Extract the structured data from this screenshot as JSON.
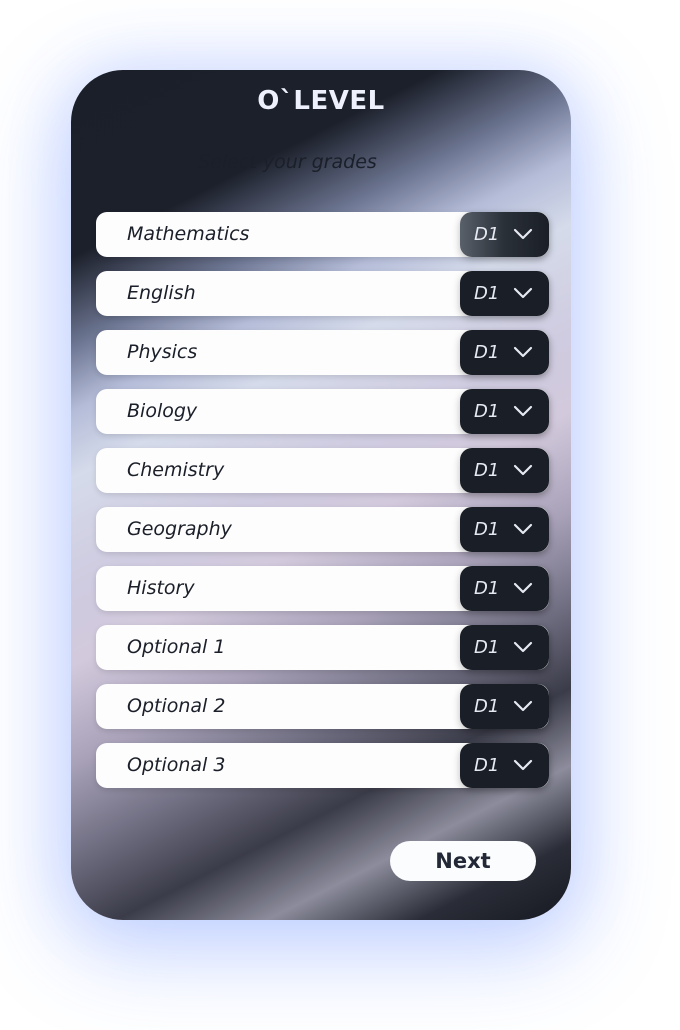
{
  "app": {
    "title": "O`LEVEL",
    "subtitle": "Select your grades"
  },
  "subjects": [
    {
      "name": "Mathematics",
      "grade": "D1"
    },
    {
      "name": "English",
      "grade": "D1"
    },
    {
      "name": "Physics",
      "grade": "D1"
    },
    {
      "name": "Biology",
      "grade": "D1"
    },
    {
      "name": "Chemistry",
      "grade": "D1"
    },
    {
      "name": "Geography",
      "grade": "D1"
    },
    {
      "name": "History",
      "grade": "D1"
    },
    {
      "name": "Optional 1",
      "grade": "D1"
    },
    {
      "name": "Optional 2",
      "grade": "D1"
    },
    {
      "name": "Optional 3",
      "grade": "D1"
    }
  ],
  "dropdown_icon": "chevron-down-icon",
  "actions": {
    "next_label": "Next"
  },
  "colors": {
    "card_dark": "#1b1f29",
    "row_background": "#fdfdfd",
    "select_background": "#1a1f27",
    "glow": "#4678ff"
  }
}
